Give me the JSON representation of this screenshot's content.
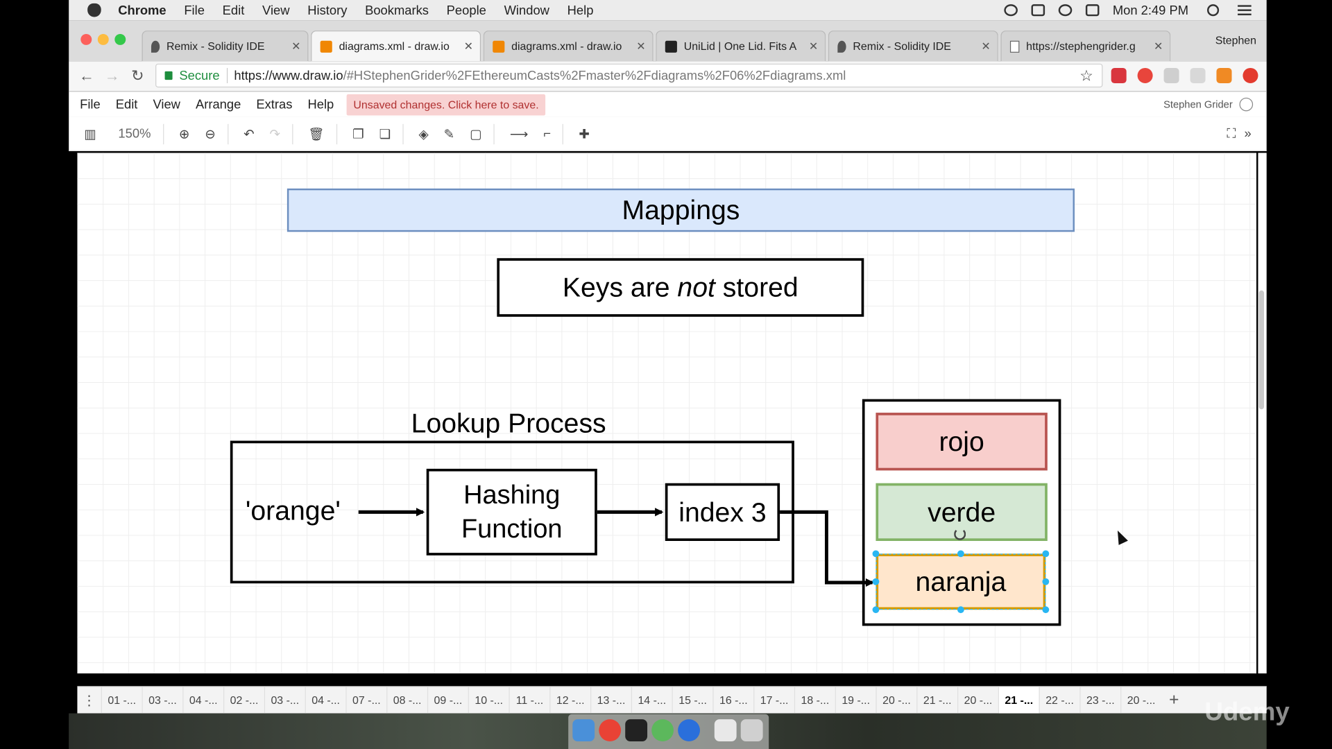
{
  "menubar": {
    "app": "Chrome",
    "items": [
      "File",
      "Edit",
      "View",
      "History",
      "Bookmarks",
      "People",
      "Window",
      "Help"
    ],
    "clock": "Mon 2:49 PM"
  },
  "browser": {
    "tabs": [
      {
        "title": "Remix - Solidity IDE",
        "icon": "remix-icon"
      },
      {
        "title": "diagrams.xml - draw.io",
        "icon": "drawio-icon"
      },
      {
        "title": "diagrams.xml - draw.io",
        "icon": "drawio-icon"
      },
      {
        "title": "UniLid | One Lid. Fits A",
        "icon": "unilid-icon"
      },
      {
        "title": "Remix - Solidity IDE",
        "icon": "remix-icon"
      },
      {
        "title": "https://stephengrider.g",
        "icon": "page-icon"
      }
    ],
    "profile": "Stephen",
    "secure_label": "Secure",
    "url_host": "https://www.draw.io",
    "url_path": "/#HStephenGrider%2FEthereumCasts%2Fmaster%2Fdiagrams%2F06%2Fdiagrams.xml"
  },
  "drawio": {
    "menu": [
      "File",
      "Edit",
      "View",
      "Arrange",
      "Extras",
      "Help"
    ],
    "unsaved": "Unsaved changes. Click here to save.",
    "user": "Stephen Grider",
    "zoom": "150%"
  },
  "diagram": {
    "title": "Mappings",
    "keys_prefix": "Keys are ",
    "keys_em": "not",
    "keys_suffix": " stored",
    "lookup_title": "Lookup Process",
    "key": "'orange'",
    "hash_line1": "Hashing",
    "hash_line2": "Function",
    "index": "index 3",
    "values": [
      "rojo",
      "verde",
      "naranja"
    ]
  },
  "pages": [
    "01 -...",
    "03 -...",
    "04 -...",
    "02 -...",
    "03 -...",
    "04 -...",
    "07 -...",
    "08 -...",
    "09 -...",
    "10 -...",
    "11 -...",
    "12 -...",
    "13 -...",
    "14 -...",
    "15 -...",
    "16 -...",
    "17 -...",
    "18 -...",
    "19 -...",
    "20 -...",
    "21 -...",
    "20 -...",
    "21 -...",
    "22 -...",
    "23 -...",
    "20 -..."
  ],
  "active_page_index": 22,
  "colors": {
    "title_fill": "#dae8fc",
    "rojo_fill": "#f8cecc",
    "verde_fill": "#d5e8d4",
    "naranja_fill": "#ffe6cc",
    "selection": "#29b6f2"
  },
  "watermark": "Udemy"
}
